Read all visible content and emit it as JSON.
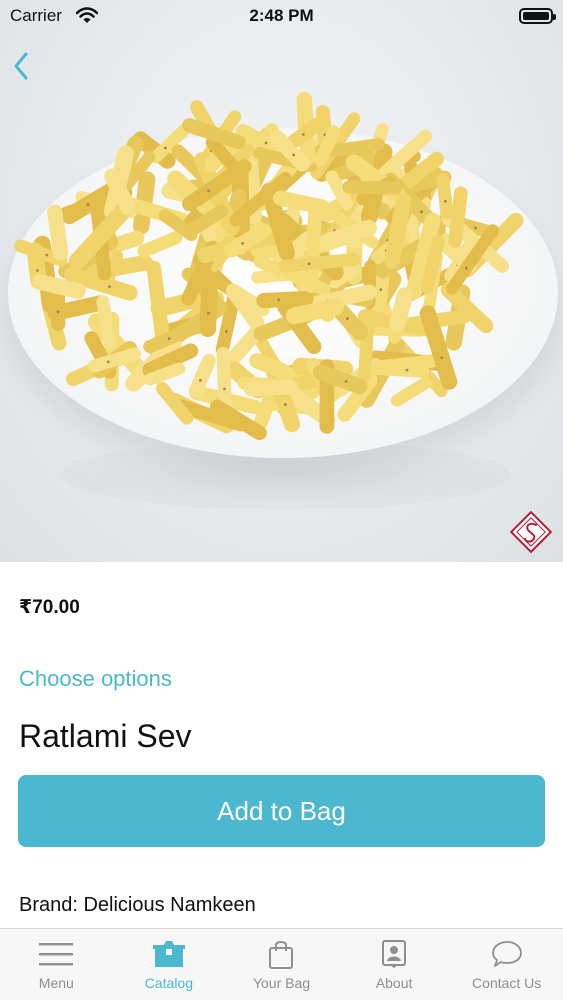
{
  "status_bar": {
    "carrier": "Carrier",
    "time": "2:48 PM"
  },
  "product": {
    "price": "₹70.00",
    "choose_options_label": "Choose options",
    "title": "Ratlami Sev",
    "add_to_bag_label": "Add to Bag",
    "brand": "Brand: Delicious Namkeen"
  },
  "colors": {
    "accent": "#4bb8cf",
    "tab_inactive": "#8e8e93",
    "logo": "#b0203a"
  },
  "tab_bar": {
    "items": [
      {
        "label": "Menu",
        "icon": "menu-icon",
        "active": false
      },
      {
        "label": "Catalog",
        "icon": "catalog-icon",
        "active": true
      },
      {
        "label": "Your Bag",
        "icon": "bag-icon",
        "active": false
      },
      {
        "label": "About",
        "icon": "about-icon",
        "active": false
      },
      {
        "label": "Contact Us",
        "icon": "chat-icon",
        "active": false
      }
    ]
  }
}
